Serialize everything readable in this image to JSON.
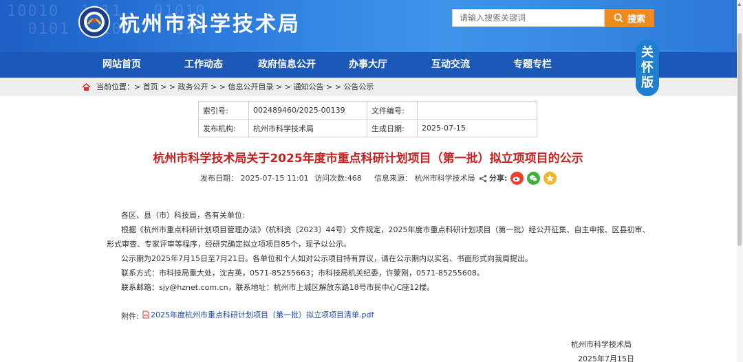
{
  "header": {
    "site_title": "杭州市科学技术局",
    "search_placeholder": "请输入搜索关键词",
    "search_label": "搜索",
    "decor_binary": "10010  1011   01010\n  0101   1001   110"
  },
  "nav": {
    "items": [
      "网站首页",
      "工作动态",
      "政府信息公开",
      "办事大厅",
      "互动交流",
      "专题专栏"
    ]
  },
  "breadcrumb": {
    "text": "当前位置：> 首页 > > 政务公开 > > 信息公开目录 > > 通知公告 > > 公告公示"
  },
  "care_badge": [
    "关",
    "怀",
    "版"
  ],
  "info_table": {
    "rows": [
      [
        "索引号:",
        "002489460/2025-00139",
        "文件编号:",
        ""
      ],
      [
        "发布机构:",
        "杭州市科学技术局",
        "生成日期:",
        "2025-07-15"
      ]
    ]
  },
  "article": {
    "title": "杭州市科学技术局关于2025年度市重点科研计划项目（第一批）拟立项项目的公示",
    "publish_date": "发布日期： 2025-07-15 11:01",
    "views": "访问次数:468",
    "source": "信息来源： 杭州市科学技术局",
    "share_label": "分享:",
    "paragraphs": [
      "各区、县（市）科技局，各有关单位:",
      "根据《杭州市重点科研计划项目管理办法》（杭科资〔2023〕44号）文件规定，2025年度市重点科研计划项目（第一批）经公开征集、自主申报、区县初审、",
      "形式审查、专家评审等程序，经研究确定拟立项项目85个，现予以公示。",
      "公示期为2025年7月15日至7月21日。各单位和个人如对公示项目持有异议，请在公示期内以实名、书面形式向我局提出。",
      "联系方式：市科技局重大处，沈吉英，0571-85255663；市科技局机关纪委，许蒙刚，0571-85255608。",
      "联系邮箱：sjy@hznet.com.cn，联系地址：杭州市上城区解放东路18号市民中心C座12楼。"
    ],
    "attachment_label": "附件:",
    "attachment_file": "2025年度杭州市重点科研计划项目（第一批）拟立项项目清单.pdf",
    "signature_org": "杭州市科学技术局",
    "signature_date": "2025年7月15日"
  },
  "colors": {
    "header_blue": "#2f80e0",
    "nav_blue": "#1b58b8",
    "title_red": "#c8201e",
    "search_orange": "#f08a1c",
    "weibo_red": "#e8402e",
    "wechat_green": "#3cb034",
    "qzone_yellow": "#f2b526"
  }
}
